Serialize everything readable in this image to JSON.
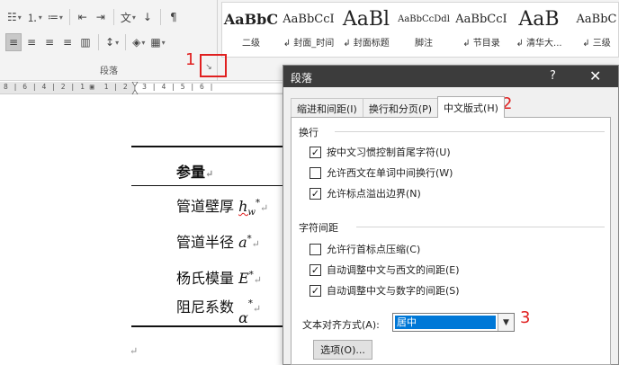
{
  "ribbon": {
    "paragraph_group_label": "段落",
    "toolbar_row1": [
      {
        "glyph": "☷",
        "icon": "bullets-icon",
        "dd": true
      },
      {
        "glyph": "⒈",
        "icon": "numbering-icon",
        "dd": true
      },
      {
        "glyph": "≔",
        "icon": "multilevel-list-icon",
        "dd": true
      },
      {
        "glyph": "⇤",
        "icon": "decrease-indent-icon",
        "dd": false
      },
      {
        "glyph": "⇥",
        "icon": "increase-indent-icon",
        "dd": false
      },
      {
        "glyph": "文",
        "icon": "chinese-layout-icon",
        "dd": true
      },
      {
        "glyph": "↓",
        "icon": "sort-icon",
        "dd": false
      },
      {
        "glyph": "¶",
        "icon": "show-marks-icon",
        "dd": false
      }
    ],
    "toolbar_row2": [
      {
        "glyph": "≡",
        "icon": "align-left-icon",
        "active": true
      },
      {
        "glyph": "≡",
        "icon": "align-center-icon",
        "active": false
      },
      {
        "glyph": "≡",
        "icon": "align-right-icon",
        "active": false
      },
      {
        "glyph": "≡",
        "icon": "justify-icon",
        "active": false
      },
      {
        "glyph": "▥",
        "icon": "distributed-icon",
        "active": false
      },
      {
        "glyph": "↕",
        "icon": "line-spacing-icon",
        "dd": true
      },
      {
        "glyph": "◈",
        "icon": "shading-icon",
        "dd": true
      },
      {
        "glyph": "▦",
        "icon": "borders-icon",
        "dd": true
      }
    ],
    "styles": [
      {
        "preview": "AaBbC",
        "name": "二级",
        "size": 16,
        "bold": true
      },
      {
        "preview": "AaBbCcI",
        "name": "↲ 封面_时间",
        "size": 13,
        "bold": false
      },
      {
        "preview": "AaBl",
        "name": "↲ 封面标题",
        "size": 22,
        "bold": false
      },
      {
        "preview": "AaBbCcDdl",
        "name": "脚注",
        "size": 10,
        "bold": false
      },
      {
        "preview": "AaBbCcI",
        "name": "↲ 节目录",
        "size": 13,
        "bold": false
      },
      {
        "preview": "AaB",
        "name": "↲ 清华大...",
        "size": 22,
        "bold": false
      },
      {
        "preview": "AaBbC",
        "name": "↲ 三级",
        "size": 13,
        "bold": false
      }
    ]
  },
  "ruler": {
    "text": "8 | 6 | 4 | 2 | 1 ▣  1 | 2 | 3 | 4 | 5 | 6 |"
  },
  "annotations": {
    "n1": "1",
    "n2": "2",
    "n3": "3"
  },
  "document": {
    "header": "参量",
    "rows": [
      {
        "label": "管道壁厚 ",
        "var": "h",
        "sub": "w",
        "sup": "*"
      },
      {
        "label": "管道半径 ",
        "var": "a",
        "sub": "",
        "sup": "*"
      },
      {
        "label": "杨氏模量 ",
        "var": "E",
        "sub": "",
        "sup": "*"
      },
      {
        "label": "阻尼系数 ",
        "var": "α",
        "sub": "",
        "sup": "*"
      }
    ],
    "para_mark": "↵"
  },
  "dialog": {
    "title": "段落",
    "help": "?",
    "close": "✕",
    "tabs": [
      {
        "label": "缩进和间距(I)",
        "active": false
      },
      {
        "label": "换行和分页(P)",
        "active": false
      },
      {
        "label": "中文版式(H)",
        "active": true
      }
    ],
    "section1": {
      "title": "换行",
      "options": [
        {
          "label": "按中文习惯控制首尾字符(U)",
          "checked": true
        },
        {
          "label": "允许西文在单词中间换行(W)",
          "checked": false
        },
        {
          "label": "允许标点溢出边界(N)",
          "checked": true
        }
      ]
    },
    "section2": {
      "title": "字符间距",
      "options": [
        {
          "label": "允许行首标点压缩(C)",
          "checked": false
        },
        {
          "label": "自动调整中文与西文的间距(E)",
          "checked": true
        },
        {
          "label": "自动调整中文与数字的间距(S)",
          "checked": true
        }
      ]
    },
    "align_label": "文本对齐方式(A):",
    "align_value": "居中",
    "options_button": "选项(O)..."
  }
}
